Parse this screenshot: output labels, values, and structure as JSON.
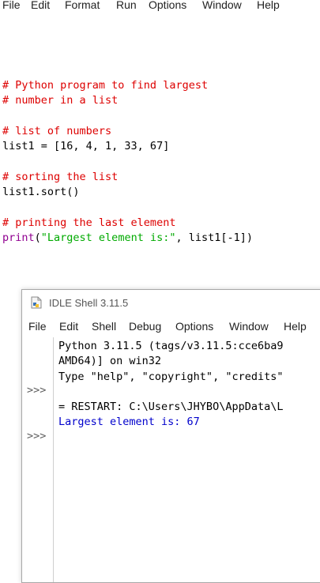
{
  "editor": {
    "menu": [
      "File",
      "Edit",
      "Format",
      "Run",
      "Options",
      "Window",
      "Help"
    ],
    "code": {
      "l1": "# Python program to find largest",
      "l2": "# number in a list",
      "l3": "# list of numbers",
      "l4": "list1 = [16, 4, 1, 33, 67]",
      "l5": "# sorting the list",
      "l6": "list1.sort()",
      "l7": "# printing the last element",
      "l8_func": "print",
      "l8_open": "(",
      "l8_str": "\"Largest element is:\"",
      "l8_rest": ", list1[-1])"
    }
  },
  "shell": {
    "title": "IDLE Shell 3.11.5",
    "menu": [
      "File",
      "Edit",
      "Shell",
      "Debug",
      "Options",
      "Window",
      "Help"
    ],
    "prompt": ">>>",
    "lines": {
      "banner1": "Python 3.11.5 (tags/v3.11.5:cce6ba9",
      "banner2": "AMD64)] on win32",
      "banner3": "Type \"help\", \"copyright\", \"credits\"",
      "restart": "= RESTART: C:\\Users\\JHYBO\\AppData\\L",
      "output": "Largest element is: 67"
    }
  }
}
